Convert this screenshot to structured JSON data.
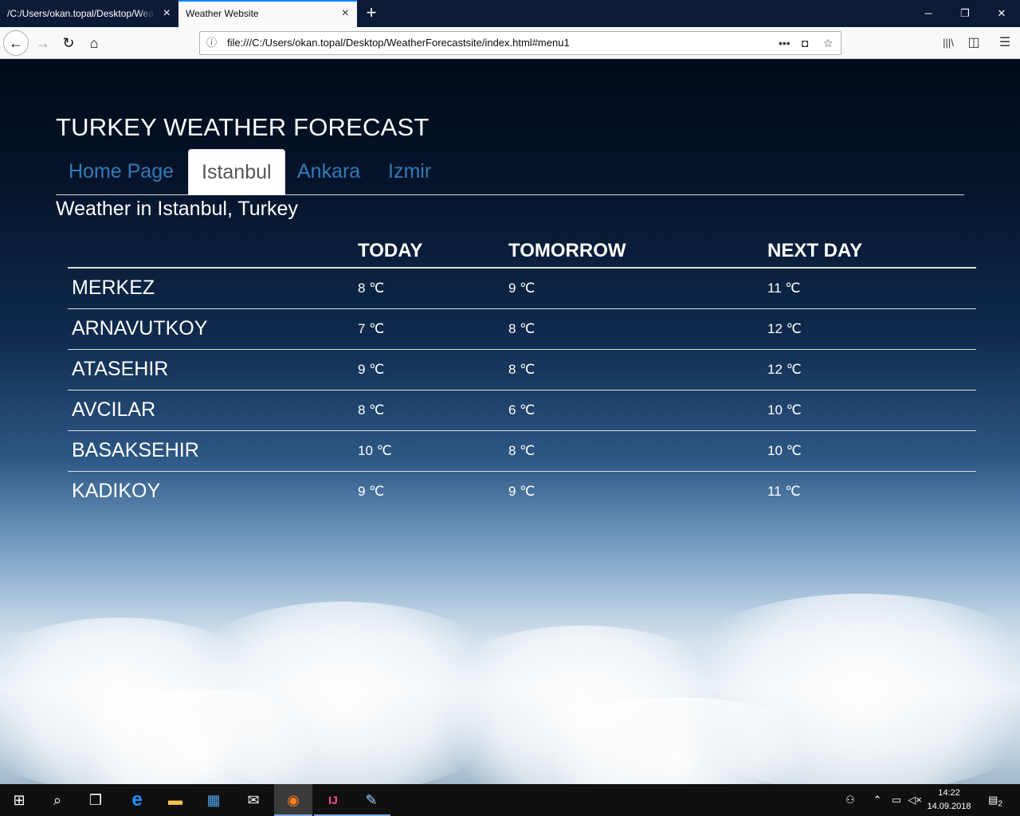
{
  "browser": {
    "tabs": [
      {
        "title": "/C:/Users/okan.topal/Desktop/Wea",
        "active": false
      },
      {
        "title": "Weather Website",
        "active": true
      }
    ],
    "url": "file:///C:/Users/okan.topal/Desktop/WeatherForecastsite/index.html#menu1",
    "icons": {
      "close": "×",
      "new_tab": "+",
      "minimize": "─",
      "restore": "❐",
      "window_close": "✕",
      "back": "←",
      "forward": "→",
      "reload": "↻",
      "home": "⌂",
      "info": "ⓘ",
      "more": "•••",
      "pocket": "◘",
      "star": "☆",
      "library": "|||\\",
      "sidebar": "◫",
      "menu": "☰"
    }
  },
  "site": {
    "title": "TURKEY WEATHER FORECAST",
    "menu": [
      {
        "label": "Home Page",
        "active": false
      },
      {
        "label": "Istanbul",
        "active": true
      },
      {
        "label": "Ankara",
        "active": false
      },
      {
        "label": "Izmir",
        "active": false
      }
    ],
    "heading": "Weather in Istanbul, Turkey",
    "table": {
      "headers": [
        "",
        "TODAY",
        "TOMORROW",
        "NEXT DAY"
      ],
      "rows": [
        {
          "district": "MERKEZ",
          "today": "8 ℃",
          "tomorrow": "9 ℃",
          "next": "11 ℃"
        },
        {
          "district": "ARNAVUTKOY",
          "today": "7 ℃",
          "tomorrow": "8 ℃",
          "next": "12 ℃"
        },
        {
          "district": "ATASEHIR",
          "today": "9 ℃",
          "tomorrow": "8 ℃",
          "next": "12 ℃"
        },
        {
          "district": "AVCILAR",
          "today": "8 ℃",
          "tomorrow": "6 ℃",
          "next": "10 ℃"
        },
        {
          "district": "BASAKSEHIR",
          "today": "10 ℃",
          "tomorrow": "8 ℃",
          "next": "10 ℃"
        },
        {
          "district": "KADIKOY",
          "today": "9 ℃",
          "tomorrow": "9 ℃",
          "next": "11 ℃"
        }
      ]
    }
  },
  "taskbar": {
    "time": "14:22",
    "date": "14.09.2018",
    "notification_count": "2",
    "icons": {
      "start": "⊞",
      "search": "⌕",
      "task_view": "❒",
      "edge": "e",
      "explorer": "▬",
      "store": "▦",
      "mail": "✉",
      "firefox": "◉",
      "intellij": "IJ",
      "paint": "✎",
      "people": "⚇",
      "tray_up": "⌃",
      "network": "▭",
      "volume": "◁×",
      "action_center": "▤"
    }
  }
}
